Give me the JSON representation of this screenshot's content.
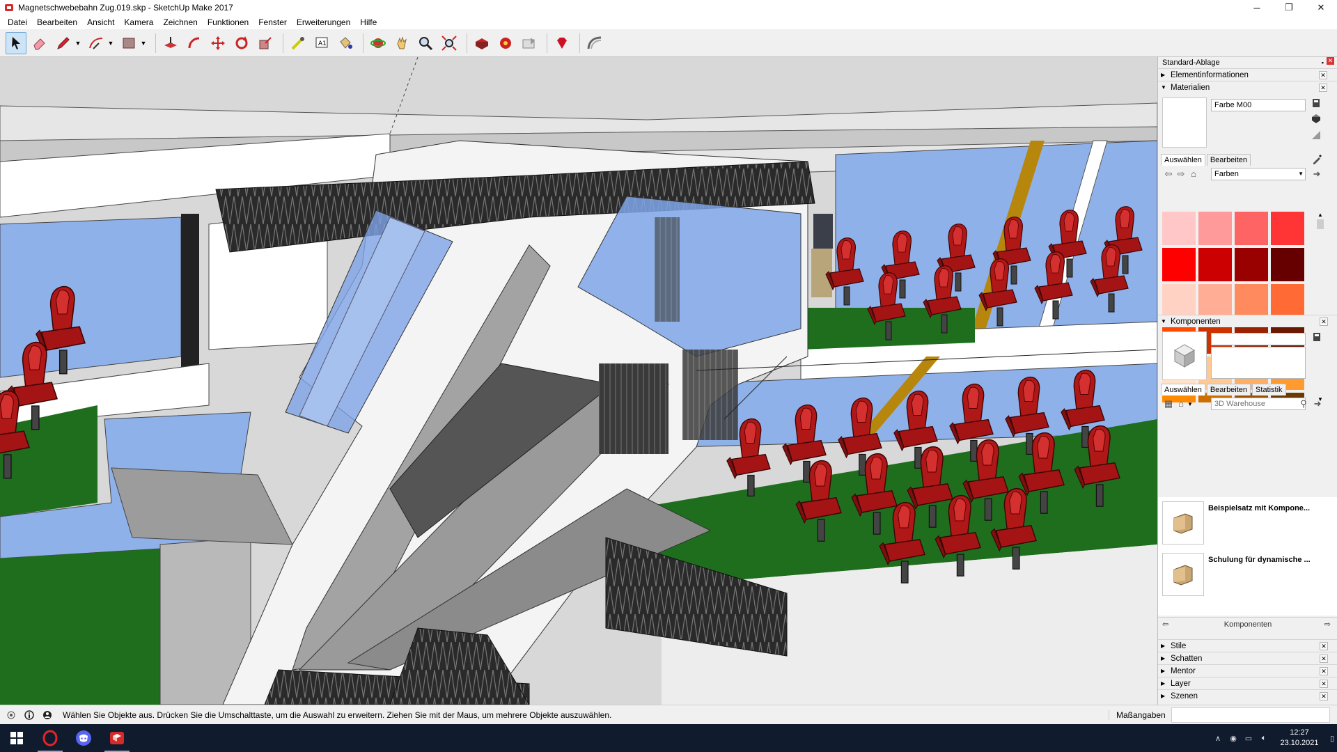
{
  "window": {
    "title": "Magnetschwebebahn Zug.019.skp - SketchUp Make 2017",
    "minimize": "─",
    "maximize": "❐",
    "close": "✕"
  },
  "menu": [
    "Datei",
    "Bearbeiten",
    "Ansicht",
    "Kamera",
    "Zeichnen",
    "Funktionen",
    "Fenster",
    "Erweiterungen",
    "Hilfe"
  ],
  "toolbar": {
    "tools": [
      "select-tool",
      "eraser-tool",
      "line-tool",
      "arc-tool",
      "rectangle-tool",
      "push-pull-tool",
      "follow-me-tool",
      "move-tool",
      "rotate-tool",
      "scale-tool",
      "tape-measure-tool",
      "text-tool",
      "paint-bucket-tool",
      "orbit-tool",
      "pan-tool",
      "zoom-tool",
      "zoom-extents-tool",
      "warehouse-tool",
      "extension-warehouse-tool",
      "share-model-tool",
      "extension-manager-tool",
      "sandbox-tool"
    ],
    "selected": "select-tool"
  },
  "tray": {
    "title": "Standard-Ablage",
    "panels": {
      "entity_info": "Elementinformationen",
      "materials": "Materialien",
      "components": "Komponenten",
      "styles": "Stile",
      "shadows": "Schatten",
      "mentor": "Mentor",
      "layers": "Layer",
      "scenes": "Szenen"
    },
    "materials": {
      "name": "Farbe M00",
      "tab_select": "Auswählen",
      "tab_edit": "Bearbeiten",
      "library": "Farben",
      "swatches": [
        "#ffc7c7",
        "#ff9a9a",
        "#ff6464",
        "#ff3434",
        "#ff0000",
        "#cc0000",
        "#990000",
        "#660000",
        "#ffd2c4",
        "#ffad94",
        "#ff8a5e",
        "#ff6a35",
        "#ff4a00",
        "#cc3300",
        "#992200",
        "#6a1800",
        "#ffe2c8",
        "#ffc995",
        "#ffae63",
        "#ff9b2e",
        "#ff8a00",
        "#cc6e00",
        "#995300",
        "#6a3a00"
      ]
    },
    "components": {
      "tab_select": "Auswählen",
      "tab_edit": "Bearbeiten",
      "tab_stats": "Statistik",
      "search_placeholder": "3D Warehouse",
      "items": [
        "Beispielsatz mit Kompone...",
        "Schulung für dynamische ..."
      ],
      "footer": "Komponenten"
    }
  },
  "status": {
    "message": "Wählen Sie Objekte aus. Drücken Sie die Umschalttaste, um die Auswahl zu erweitern. Ziehen Sie mit der Maus, um mehrere Objekte auszuwählen.",
    "measurements_label": "Maßangaben",
    "measurements_value": ""
  },
  "taskbar": {
    "time": "12:27",
    "date": "23.10.2021"
  },
  "colors": {
    "seat_red": "#b01818",
    "floor_green": "#1e6e1e",
    "glass_blue": "#7ea4e6",
    "taskbar_bg": "#101b2e"
  }
}
